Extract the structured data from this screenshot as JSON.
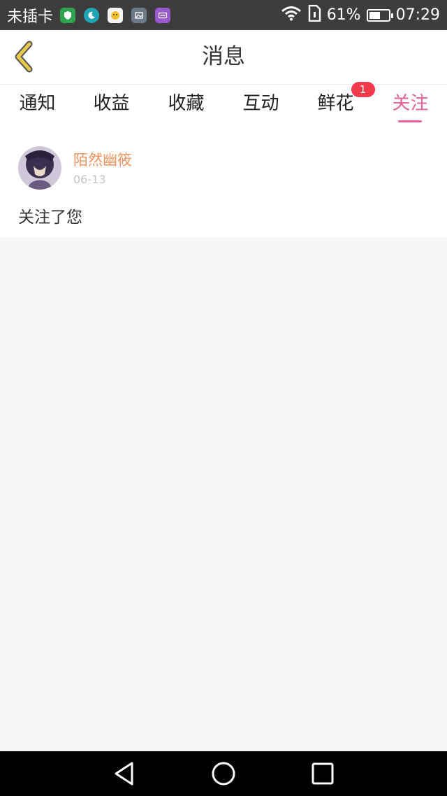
{
  "status_bar": {
    "carrier": "未插卡",
    "notification_icons": [
      "shield-app-icon",
      "moon-app-icon",
      "chat-app-icon",
      "gallery-app-icon",
      "keyboard-app-icon"
    ],
    "battery_percent": "61%",
    "battery_level": 0.61,
    "time": "07:29"
  },
  "header": {
    "title": "消息"
  },
  "tabs": [
    {
      "label": "通知",
      "active": false
    },
    {
      "label": "收益",
      "active": false
    },
    {
      "label": "收藏",
      "active": false
    },
    {
      "label": "互动",
      "active": false
    },
    {
      "label": "鲜花",
      "active": false,
      "badge": "1"
    },
    {
      "label": "关注",
      "active": true
    }
  ],
  "feed": [
    {
      "username": "陌然幽筱",
      "date": "06-13",
      "message": "关注了您"
    }
  ],
  "colors": {
    "accent": "#e8609a",
    "username": "#f0935c",
    "badge": "#f23a4b",
    "status_bar_bg": "#3d3d3d",
    "back_arrow": "#e8c84a"
  }
}
